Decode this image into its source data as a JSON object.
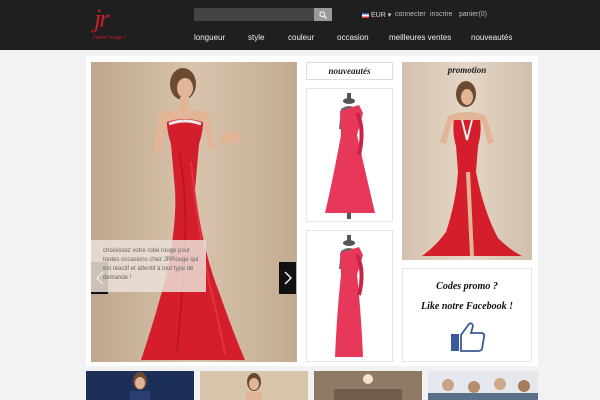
{
  "brand": {
    "logo_text": "jr",
    "tagline": "J'aime rouge !"
  },
  "search": {
    "placeholder": ""
  },
  "topbar": {
    "currency": "EUR",
    "login": "connecter",
    "register": "inscrire",
    "cart": "panier(0)"
  },
  "nav": [
    "longueur",
    "style",
    "couleur",
    "occasion",
    "meilleures ventes",
    "nouveautés"
  ],
  "hero": {
    "caption": "choisissez votre robe rouge pour toutes occasions chez JRRouge qui est réactif et attentif à tout type de demande !"
  },
  "sections": {
    "new_title": "nouveautés",
    "promo_title": "promotion"
  },
  "promo_box": {
    "line1": "Codes promo ?",
    "line2": "Like notre Facebook !"
  },
  "icons": {
    "search": "search-icon",
    "prev": "chevron-left-icon",
    "next": "chevron-right-icon",
    "like": "thumbs-up-icon"
  },
  "colors": {
    "header_bg": "#1f1f1f",
    "brand_red": "#c8202a",
    "dress_red": "#d41e2b",
    "dress_pink": "#e8385a",
    "facebook_blue": "#3b5998"
  }
}
